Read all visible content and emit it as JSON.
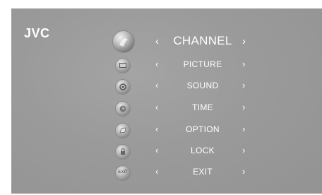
{
  "brand": {
    "logo_text": "JVC"
  },
  "menu": {
    "left_arrow": "‹",
    "right_arrow": "›",
    "items": [
      {
        "label": "CHANNEL",
        "icon": "channel-icon",
        "selected": true
      },
      {
        "label": "PICTURE",
        "icon": "picture-icon",
        "selected": false
      },
      {
        "label": "SOUND",
        "icon": "sound-icon",
        "selected": false
      },
      {
        "label": "TIME",
        "icon": "time-icon",
        "selected": false
      },
      {
        "label": "OPTION",
        "icon": "option-icon",
        "selected": false
      },
      {
        "label": "LOCK",
        "icon": "lock-icon",
        "selected": false
      },
      {
        "label": "EXIT",
        "icon": "exit-icon",
        "icon_text": "EXIT",
        "selected": false
      }
    ]
  },
  "colors": {
    "background": "#9a9a9a",
    "text": "#ffffff"
  }
}
